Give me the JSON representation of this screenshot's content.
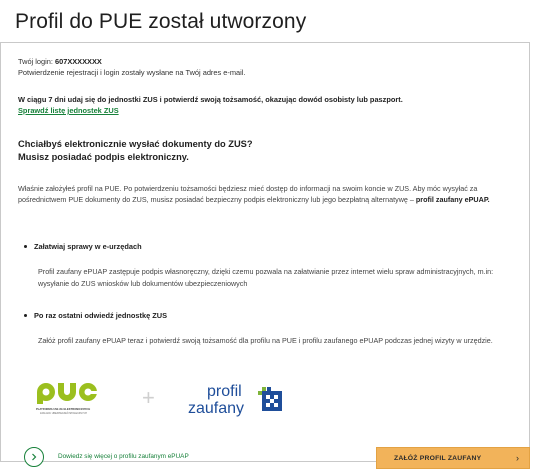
{
  "page": {
    "title": "Profil do PUE został utworzony"
  },
  "account": {
    "login_label": "Twój login:",
    "login_value": "607XXXXXXX",
    "confirmation_text": "Potwierdzenie rejestracji i login zostały wysłane na Twój adres e-mail."
  },
  "verify": {
    "instruction": "W ciągu 7 dni udaj się do jednostki ZUS i potwierdź swoją tożsamość, okazując dowód osobisty lub paszport.",
    "link_label": "Sprawdź listę jednostek ZUS"
  },
  "signature": {
    "heading_line1": "Chciałbyś elektronicznie wysłać dokumenty do ZUS?",
    "heading_line2": "Musisz posiadać podpis elektroniczny.",
    "paragraph_part1": "Właśnie założyłeś profil na PUE. Po potwierdzeniu tożsamości będziesz mieć dostęp do informacji na swoim koncie w ZUS. Aby móc wysyłać za pośrednictwem PUE dokumenty do ZUS, musisz posiadać bezpieczny podpis elektroniczny lub jego bezpłatną alternatywę –",
    "paragraph_bold": "profil zaufany ePUAP."
  },
  "bullets": [
    {
      "title": "Załatwiaj sprawy w e-urzędach",
      "text": "Profil zaufany ePUAP zastępuje podpis własnoręczny, dzięki czemu pozwala na załatwianie przez internet wielu spraw administracyjnych, m.in: wysyłanie do ZUS wniosków lub dokumentów ubezpieczeniowych"
    },
    {
      "title": "Po raz ostatni odwiedź jednostkę ZUS",
      "text": "Załóż profil zaufany ePUAP teraz i potwierdź swoją tożsamość dla profilu na PUE i profilu zaufanego ePUAP podczas jednej wizyty w urzędzie."
    }
  ],
  "logos": {
    "pue_caption_line1": "PLATFORMA USŁUG ELEKTRONICZNYCH",
    "pue_caption_line2": "ZAKŁADU UBEZPIECZEŃ SPOŁECZNYCH",
    "plus": "+",
    "pz_word1": "profil",
    "pz_word2": "zaufany"
  },
  "footer": {
    "more_label": "Dowiedz się więcej o profilu zaufanym ePUAP",
    "cta_label": "ZAŁÓŻ PROFIL ZAUFANY",
    "cta_chevron": "›"
  },
  "colors": {
    "accent_green": "#17813a",
    "pue_green": "#9bbf1e",
    "pz_blue": "#1f4e9a",
    "cta_orange": "#f2b35a"
  }
}
